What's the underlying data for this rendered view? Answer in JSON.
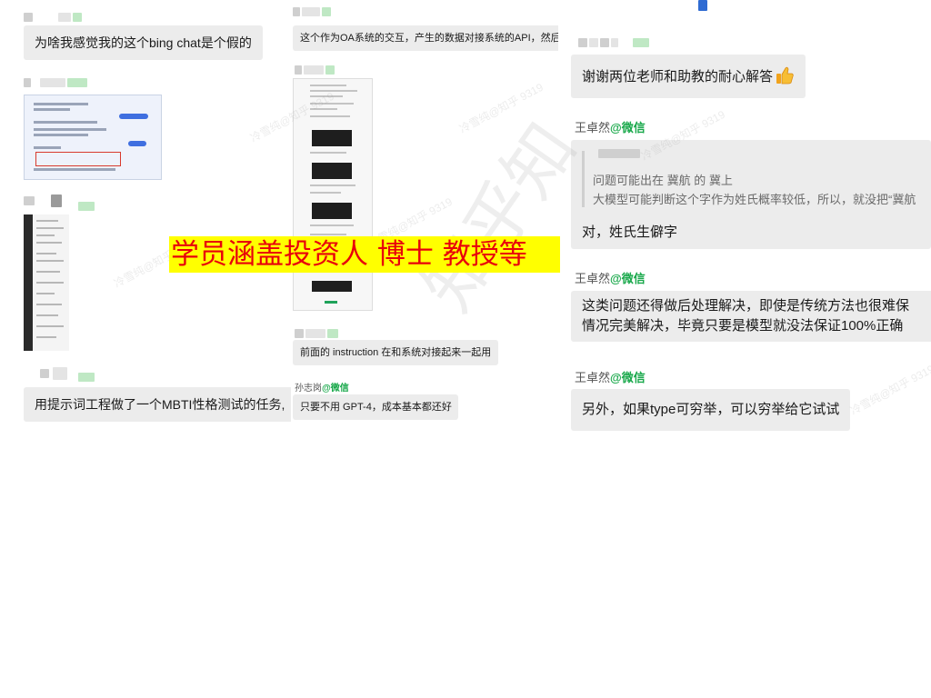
{
  "col1": {
    "msg1": "为啥我感觉我的这个bing chat是个假的",
    "msg2": "用提示词工程做了一个MBTI性格测试的任务,"
  },
  "col2": {
    "msg1": "这个作为OA系统的交互，产生的数据对接系统的API，然后",
    "msg2": "前面的 instruction 在和系统对接起来一起用",
    "sender": "孙志岗",
    "sender_tag": "@微信",
    "msg3": "只要不用 GPT-4，成本基本都还好"
  },
  "col3": {
    "msg1": "谢谢两位老师和助教的耐心解答",
    "sender1": "王卓然",
    "sender1_tag": "@微信",
    "quote_line1": "问题可能出在 冀航 的 冀上",
    "quote_line2": "大模型可能判断这个字作为姓氏概率较低，所以，就没把“冀航",
    "reply1": "对，姓氏生僻字",
    "sender2": "王卓然",
    "sender2_tag": "@微信",
    "msg2_line1": "这类问题还得做后处理解决，即使是传统方法也很难保",
    "msg2_line2": "情况完美解决，毕竟只要是模型就没法保证100%正确",
    "sender3": "王卓然",
    "sender3_tag": "@微信",
    "msg3": "另外，如果type可穷举，可以穷举给它试试"
  },
  "overlay": {
    "banner": "学员涵盖投资人 博士 教授等"
  },
  "watermark": {
    "small": "冷雪纯@知乎 9319",
    "large": "知乎知"
  },
  "colors": {
    "wechat_green": "#18a84a",
    "banner_bg": "#ffff00",
    "banner_text": "#e8000b",
    "bubble": "#ececec"
  }
}
